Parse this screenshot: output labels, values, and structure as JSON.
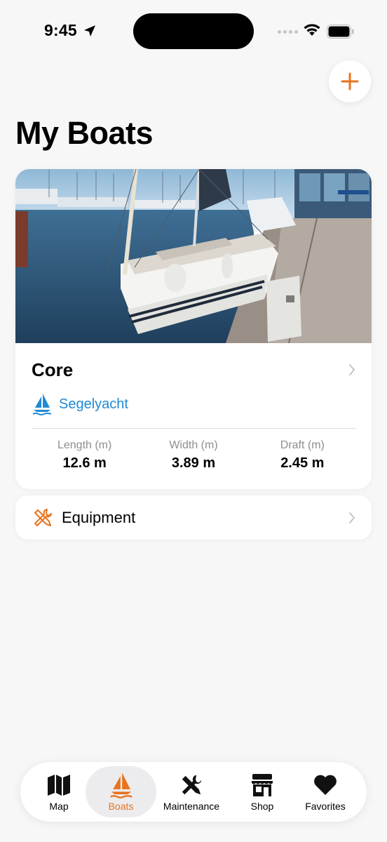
{
  "status_bar": {
    "time": "9:45"
  },
  "page": {
    "title": "My Boats"
  },
  "boat": {
    "name": "Core",
    "type": "Segelyacht",
    "dimensions": [
      {
        "label": "Length (m)",
        "value": "12.6 m"
      },
      {
        "label": "Width (m)",
        "value": "3.89 m"
      },
      {
        "label": "Draft (m)",
        "value": "2.45 m"
      }
    ]
  },
  "equipment": {
    "label": "Equipment"
  },
  "tabs": [
    {
      "label": "Map",
      "icon": "map-icon",
      "active": false
    },
    {
      "label": "Boats",
      "icon": "sailboat-icon",
      "active": true
    },
    {
      "label": "Maintenance",
      "icon": "tools-icon",
      "active": false
    },
    {
      "label": "Shop",
      "icon": "storefront-icon",
      "active": false
    },
    {
      "label": "Favorites",
      "icon": "heart-icon",
      "active": false
    }
  ],
  "colors": {
    "accent": "#E8731C",
    "link": "#1F8AD6",
    "background": "#F7F7F8"
  }
}
